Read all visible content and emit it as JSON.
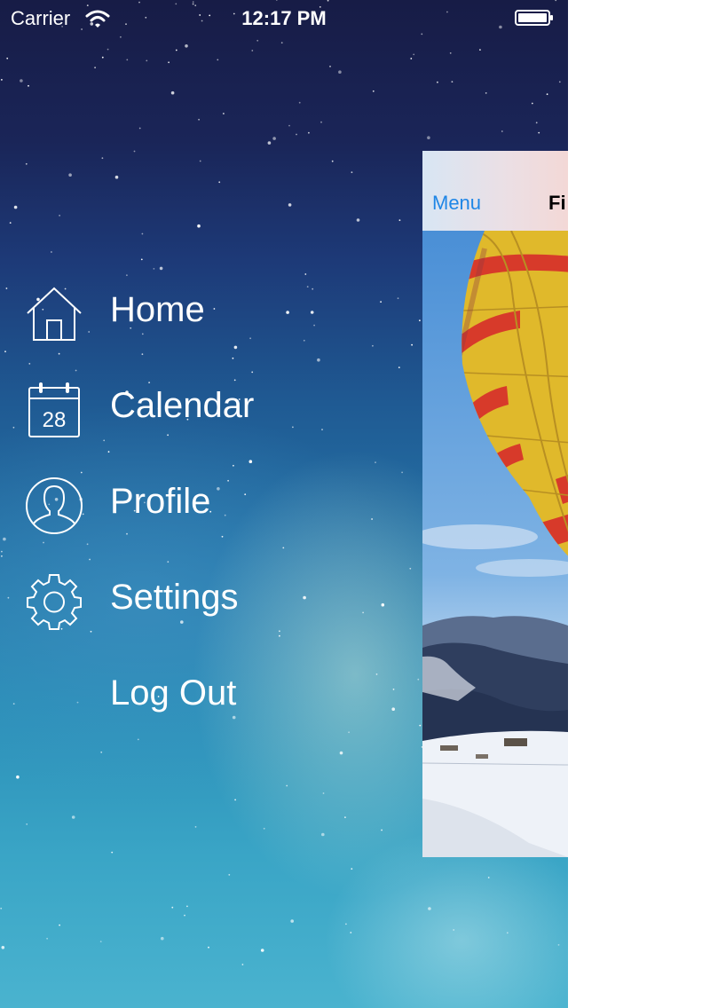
{
  "status_bar": {
    "carrier": "Carrier",
    "time": "12:17 PM",
    "wifi_icon": "wifi-icon",
    "battery_icon": "battery-icon"
  },
  "menu": {
    "items": [
      {
        "label": "Home",
        "icon": "home-icon"
      },
      {
        "label": "Calendar",
        "icon": "calendar-icon",
        "icon_text": "28"
      },
      {
        "label": "Profile",
        "icon": "profile-icon"
      },
      {
        "label": "Settings",
        "icon": "gear-icon"
      },
      {
        "label": "Log Out",
        "icon": ""
      }
    ]
  },
  "content": {
    "nav_button": "Menu",
    "nav_title": "Fi",
    "nav_button_color": "#1f86e6"
  }
}
